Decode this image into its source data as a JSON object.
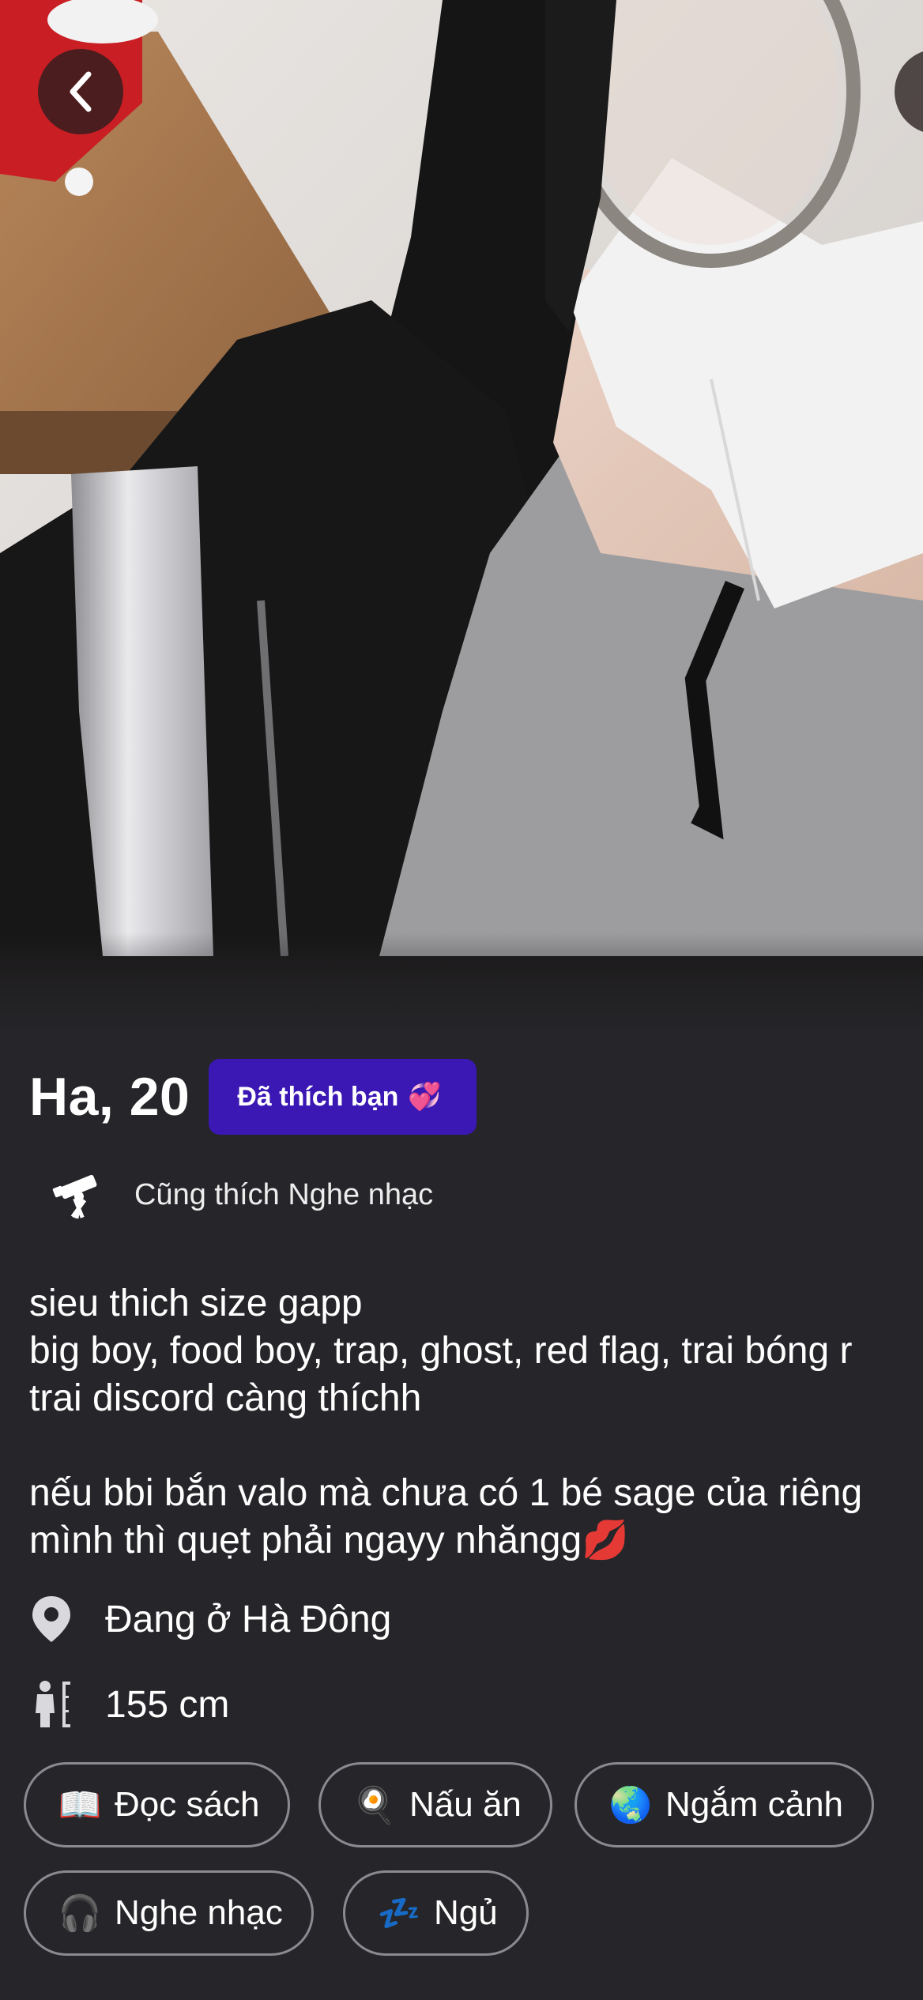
{
  "profile": {
    "name_age": "Ha, 20",
    "liked_badge": "Đã thích bạn",
    "liked_badge_emoji": "💞",
    "shared_interest": "Cũng thích Nghe nhạc",
    "bio": "sieu thich size gapp\nbig boy, food boy, trap, ghost, red flag, trai bóng r\ntrai discord càng thíchh\n\nnếu bbi bắn valo mà chưa có 1 bé sage của riêng\nmình thì quẹt phải ngayy nhăngg💋",
    "location": "Đang ở Hà Đông",
    "height": "155 cm"
  },
  "interests": [
    {
      "emoji": "📖",
      "label": "Đọc sách"
    },
    {
      "emoji": "🍳",
      "label": "Nấu ăn"
    },
    {
      "emoji": "🌏",
      "label": "Ngắm cảnh"
    },
    {
      "emoji": "🎧",
      "label": "Nghe nhạc"
    },
    {
      "emoji": "💤",
      "label": "Ngủ"
    }
  ],
  "colors": {
    "background": "#26262a",
    "badge": "#3b17b4",
    "chip_border": "#8a8a90"
  },
  "icons": {
    "back": "chevron-left-icon",
    "shared": "telescope-icon",
    "location": "map-pin-icon",
    "height": "person-height-icon"
  }
}
